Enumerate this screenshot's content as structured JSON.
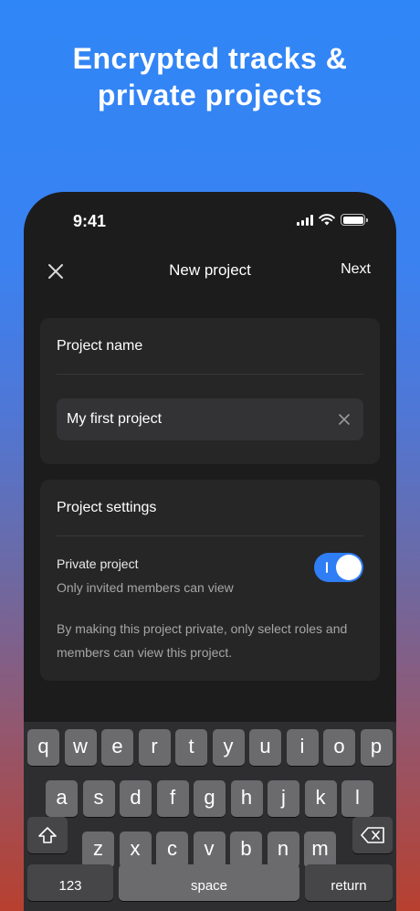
{
  "headline": {
    "line1": "Encrypted tracks &",
    "line2": "private projects"
  },
  "status_bar": {
    "time": "9:41"
  },
  "navbar": {
    "title": "New project",
    "next_label": "Next"
  },
  "project_name_card": {
    "title": "Project name",
    "input_value": "My first project"
  },
  "settings_card": {
    "title": "Project settings",
    "private_label": "Private project",
    "private_sub": "Only invited members can view",
    "private_enabled": true,
    "description": "By making this project private, only select roles and members can view this project."
  },
  "keyboard": {
    "row1": [
      "q",
      "w",
      "e",
      "r",
      "t",
      "y",
      "u",
      "i",
      "o",
      "p"
    ],
    "row2": [
      "a",
      "s",
      "d",
      "f",
      "g",
      "h",
      "j",
      "k",
      "l"
    ],
    "row3": [
      "z",
      "x",
      "c",
      "v",
      "b",
      "n",
      "m"
    ],
    "numbers_label": "123",
    "space_label": "space",
    "return_label": "return"
  },
  "colors": {
    "accent": "#2f7ef6",
    "panel": "#262627",
    "screen": "#1c1c1d"
  }
}
